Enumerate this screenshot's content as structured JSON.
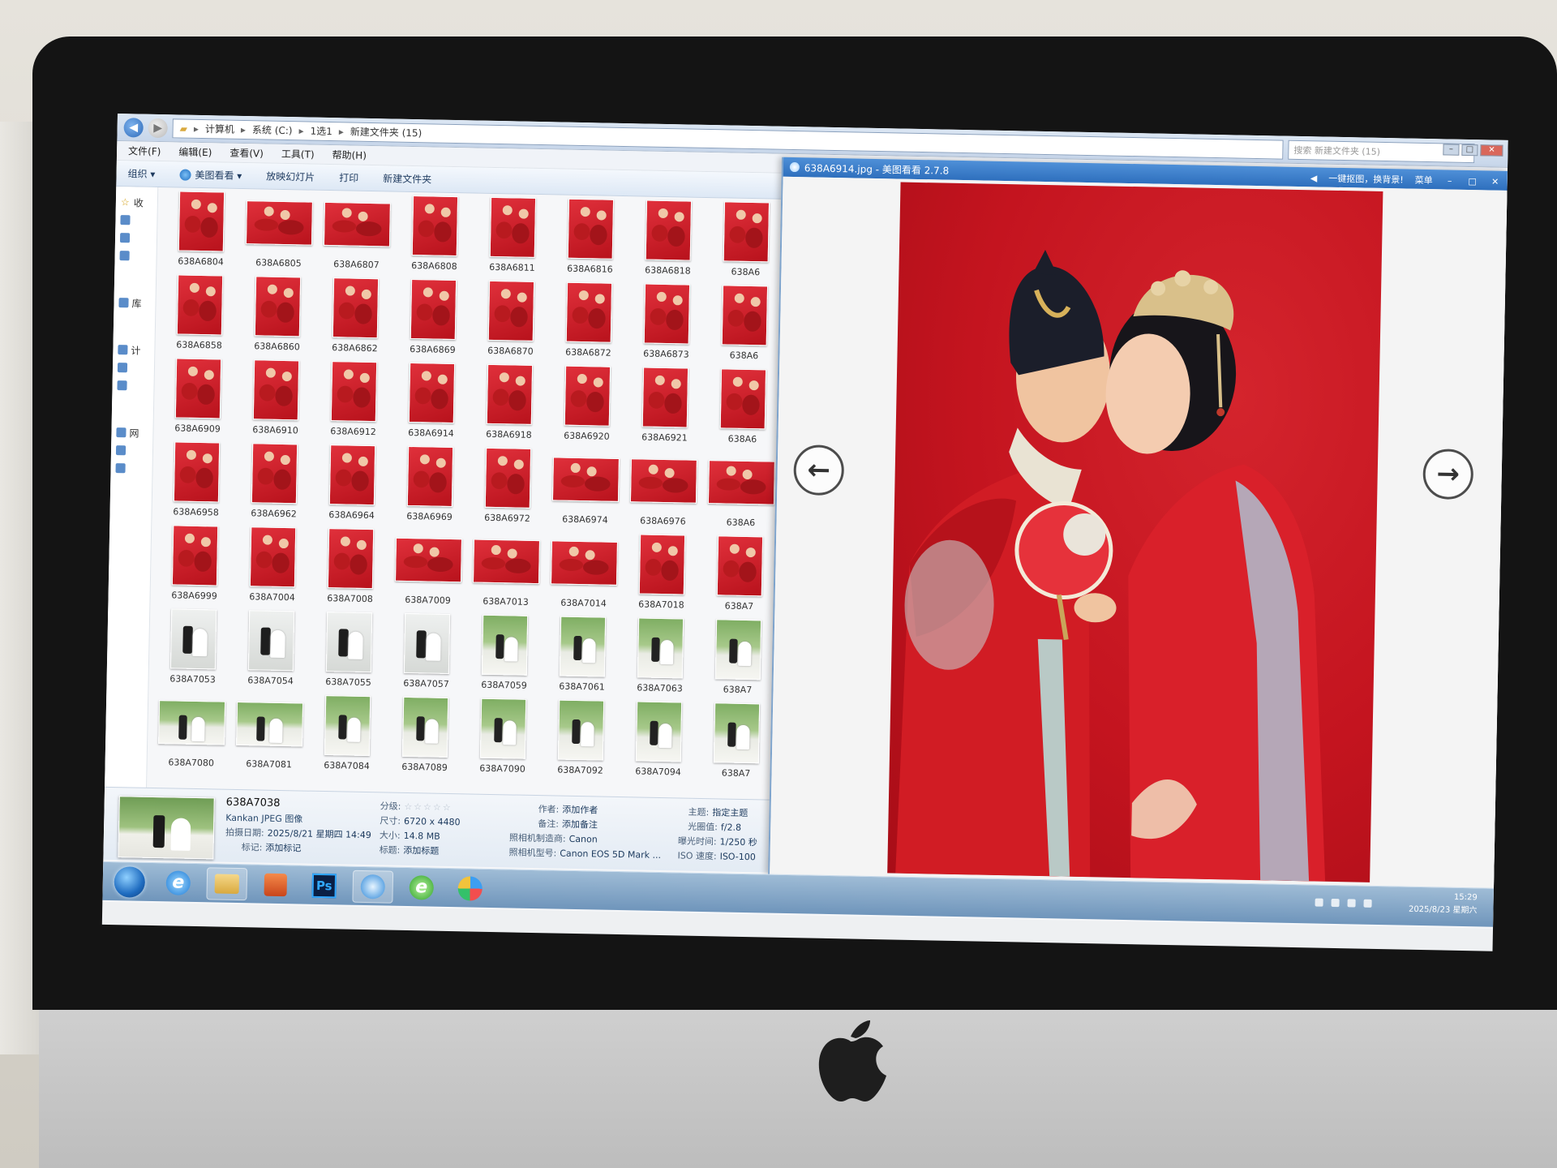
{
  "explorer": {
    "breadcrumbs": [
      "计算机",
      "系统 (C:)",
      "1选1",
      "新建文件夹 (15)"
    ],
    "search_placeholder": "搜索 新建文件夹 (15)",
    "menu": [
      "文件(F)",
      "编辑(E)",
      "查看(V)",
      "工具(T)",
      "帮助(H)"
    ],
    "toolbar": [
      "组织 ▾",
      "美图看看 ▾",
      "放映幻灯片",
      "打印",
      "新建文件夹"
    ],
    "navpane": [
      "收",
      "库",
      "计",
      "网"
    ],
    "thumbnails": [
      {
        "name": "638A6804",
        "kind": "red",
        "shape": "p"
      },
      {
        "name": "638A6805",
        "kind": "red",
        "shape": "l"
      },
      {
        "name": "638A6807",
        "kind": "red",
        "shape": "l"
      },
      {
        "name": "638A6808",
        "kind": "red",
        "shape": "p"
      },
      {
        "name": "638A6811",
        "kind": "red",
        "shape": "p"
      },
      {
        "name": "638A6816",
        "kind": "red",
        "shape": "p"
      },
      {
        "name": "638A6818",
        "kind": "red",
        "shape": "p"
      },
      {
        "name": "638A6",
        "kind": "red",
        "shape": "p"
      },
      {
        "name": "638A6858",
        "kind": "red",
        "shape": "p"
      },
      {
        "name": "638A6860",
        "kind": "red",
        "shape": "p"
      },
      {
        "name": "638A6862",
        "kind": "red",
        "shape": "p"
      },
      {
        "name": "638A6869",
        "kind": "red",
        "shape": "p"
      },
      {
        "name": "638A6870",
        "kind": "red",
        "shape": "p"
      },
      {
        "name": "638A6872",
        "kind": "red",
        "shape": "p"
      },
      {
        "name": "638A6873",
        "kind": "red",
        "shape": "p"
      },
      {
        "name": "638A6",
        "kind": "red",
        "shape": "p"
      },
      {
        "name": "638A6909",
        "kind": "red",
        "shape": "p"
      },
      {
        "name": "638A6910",
        "kind": "red",
        "shape": "p"
      },
      {
        "name": "638A6912",
        "kind": "red",
        "shape": "p"
      },
      {
        "name": "638A6914",
        "kind": "red",
        "shape": "p"
      },
      {
        "name": "638A6918",
        "kind": "red",
        "shape": "p"
      },
      {
        "name": "638A6920",
        "kind": "red",
        "shape": "p"
      },
      {
        "name": "638A6921",
        "kind": "red",
        "shape": "p"
      },
      {
        "name": "638A6",
        "kind": "red",
        "shape": "p"
      },
      {
        "name": "638A6958",
        "kind": "red",
        "shape": "p"
      },
      {
        "name": "638A6962",
        "kind": "red",
        "shape": "p"
      },
      {
        "name": "638A6964",
        "kind": "red",
        "shape": "p"
      },
      {
        "name": "638A6969",
        "kind": "red",
        "shape": "p"
      },
      {
        "name": "638A6972",
        "kind": "red",
        "shape": "p"
      },
      {
        "name": "638A6974",
        "kind": "red",
        "shape": "l"
      },
      {
        "name": "638A6976",
        "kind": "red",
        "shape": "l"
      },
      {
        "name": "638A6",
        "kind": "red",
        "shape": "l"
      },
      {
        "name": "638A6999",
        "kind": "red",
        "shape": "p"
      },
      {
        "name": "638A7004",
        "kind": "red",
        "shape": "p"
      },
      {
        "name": "638A7008",
        "kind": "red",
        "shape": "p"
      },
      {
        "name": "638A7009",
        "kind": "red",
        "shape": "l"
      },
      {
        "name": "638A7013",
        "kind": "red",
        "shape": "l"
      },
      {
        "name": "638A7014",
        "kind": "red",
        "shape": "l"
      },
      {
        "name": "638A7018",
        "kind": "red",
        "shape": "p"
      },
      {
        "name": "638A7",
        "kind": "red",
        "shape": "p"
      },
      {
        "name": "638A7053",
        "kind": "white",
        "shape": "p"
      },
      {
        "name": "638A7054",
        "kind": "white",
        "shape": "p"
      },
      {
        "name": "638A7055",
        "kind": "white",
        "shape": "p"
      },
      {
        "name": "638A7057",
        "kind": "white",
        "shape": "p"
      },
      {
        "name": "638A7059",
        "kind": "green",
        "shape": "p"
      },
      {
        "name": "638A7061",
        "kind": "green",
        "shape": "p"
      },
      {
        "name": "638A7063",
        "kind": "green",
        "shape": "p"
      },
      {
        "name": "638A7",
        "kind": "green",
        "shape": "p"
      },
      {
        "name": "638A7080",
        "kind": "green",
        "shape": "l"
      },
      {
        "name": "638A7081",
        "kind": "green",
        "shape": "l"
      },
      {
        "name": "638A7084",
        "kind": "green",
        "shape": "p"
      },
      {
        "name": "638A7089",
        "kind": "green",
        "shape": "p"
      },
      {
        "name": "638A7090",
        "kind": "green",
        "shape": "p"
      },
      {
        "name": "638A7092",
        "kind": "green",
        "shape": "p"
      },
      {
        "name": "638A7094",
        "kind": "green",
        "shape": "p"
      },
      {
        "name": "638A7",
        "kind": "green",
        "shape": "p"
      }
    ],
    "details": {
      "name": "638A7038",
      "type": "Kankan JPEG 图像",
      "rating_label": "分级:",
      "rating_stars": "☆☆☆☆☆",
      "rows": [
        {
          "k": "拍摄日期:",
          "v": "2025/8/21 星期四 14:49"
        },
        {
          "k": "标记:",
          "v": "添加标记"
        },
        {
          "k": "尺寸:",
          "v": "6720 x 4480"
        },
        {
          "k": "大小:",
          "v": "14.8 MB"
        },
        {
          "k": "标题:",
          "v": "添加标题"
        },
        {
          "k": "作者:",
          "v": "添加作者"
        },
        {
          "k": "备注:",
          "v": "添加备注"
        },
        {
          "k": "照相机制造商:",
          "v": "Canon"
        },
        {
          "k": "照相机型号:",
          "v": "Canon EOS 5D Mark ..."
        },
        {
          "k": "主题:",
          "v": "指定主题"
        },
        {
          "k": "光圈值:",
          "v": "f/2.8"
        },
        {
          "k": "曝光时间:",
          "v": "1/250 秒"
        },
        {
          "k": "ISO 速度:",
          "v": "ISO-100"
        }
      ]
    }
  },
  "viewer": {
    "title": "638A6914.jpg - 美图看看 2.7.8",
    "tagline": "一键抠图，换背景!",
    "menu_label": "菜单"
  },
  "taskbar": {
    "ps_label": "Ps",
    "ie_glyph": "e",
    "time": "15:29",
    "date": "2025/8/23 星期六"
  },
  "colors": {
    "backdrop_red": "#c4141f",
    "title_blue": "#2e6fbd",
    "taskbar_blue": "#6f95bb"
  }
}
